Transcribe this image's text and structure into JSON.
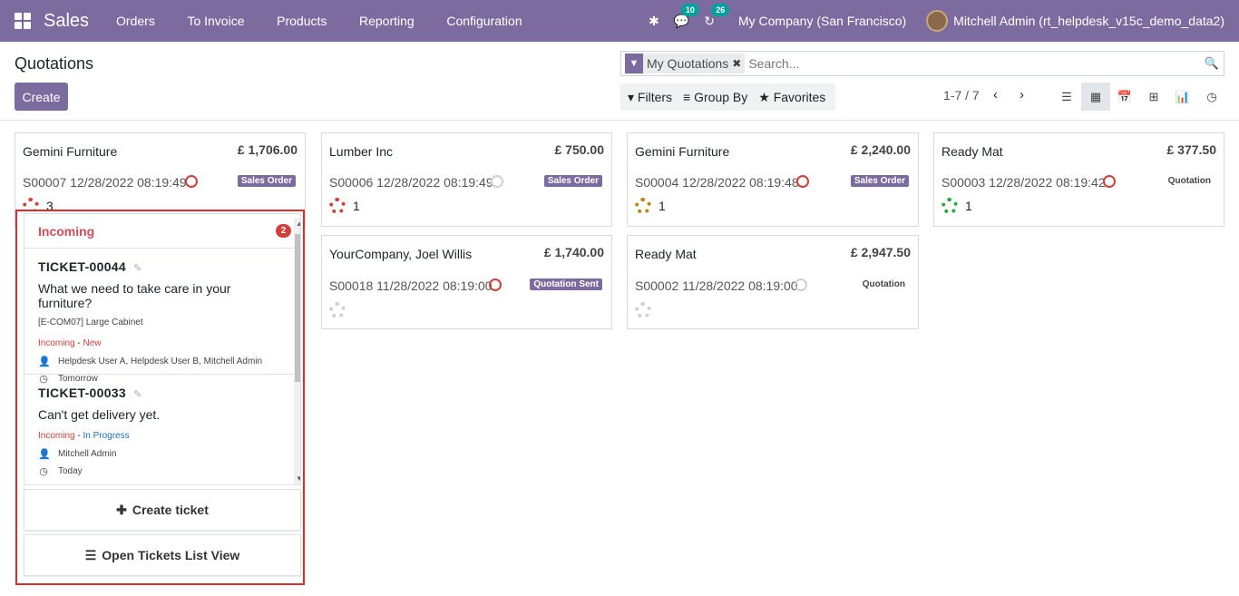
{
  "navbar": {
    "brand": "Sales",
    "menu": [
      "Orders",
      "To Invoice",
      "Products",
      "Reporting",
      "Configuration"
    ],
    "messages_count": "10",
    "activities_count": "26",
    "company": "My Company (San Francisco)",
    "user": "Mitchell Admin (rt_helpdesk_v15c_demo_data2)"
  },
  "control": {
    "title": "Quotations",
    "create_label": "Create",
    "facet_label": "My Quotations",
    "search_placeholder": "Search...",
    "filters_label": "Filters",
    "groupby_label": "Group By",
    "favorites_label": "Favorites",
    "pager": "1-7 / 7"
  },
  "cards": [
    {
      "name": "Gemini Furniture",
      "amount": "£ 1,706.00",
      "ref": "S00007 12/28/2022 08:19:49",
      "status": "Sales Order",
      "tickets": "3",
      "clock": "red",
      "buoy": "#d23f3a"
    },
    {
      "name": "Lumber Inc",
      "amount": "£ 750.00",
      "ref": "S00006 12/28/2022 08:19:49",
      "status": "Sales Order",
      "tickets": "1",
      "clock": "grey",
      "buoy": "#d23f3a"
    },
    {
      "name": "Gemini Furniture",
      "amount": "£ 2,240.00",
      "ref": "S00004 12/28/2022 08:19:48",
      "status": "Sales Order",
      "tickets": "1",
      "clock": "red",
      "buoy": "#b8860b"
    },
    {
      "name": "Ready Mat",
      "amount": "£ 377.50",
      "ref": "S00003 12/28/2022 08:19:42",
      "status": "Quotation",
      "tickets": "1",
      "clock": "red",
      "buoy": "#28a745"
    },
    {
      "name": "YourCompany, Joel Willis",
      "amount": "£ 1,740.00",
      "ref": "S00018 11/28/2022 08:19:00",
      "status": "Quotation Sent",
      "tickets": "",
      "clock": "red",
      "buoy": "#d0d0d0"
    },
    {
      "name": "Ready Mat",
      "amount": "£ 2,947.50",
      "ref": "S00002 11/28/2022 08:19:00",
      "status": "Quotation",
      "tickets": "",
      "clock": "grey",
      "buoy": "#d0d0d0"
    }
  ],
  "popup": {
    "header": "Incoming",
    "header_count": "2",
    "tickets": [
      {
        "id": "TICKET-00044",
        "question": "What we need to take care in your furniture?",
        "product": "[E-COM07] Large Cabinet",
        "team": "Incoming",
        "sep": " - ",
        "stage": "New",
        "assignees": "Helpdesk User A, Helpdesk User B, Mitchell Admin",
        "deadline": "Tomorrow"
      },
      {
        "id": "TICKET-00033",
        "question": "Can't get delivery yet.",
        "product": "",
        "team": "Incoming",
        "sep": " - ",
        "stage": "In Progress",
        "assignees": "Mitchell Admin",
        "deadline": "Today"
      }
    ],
    "create_ticket": "Create ticket",
    "open_list": "Open Tickets List View"
  }
}
